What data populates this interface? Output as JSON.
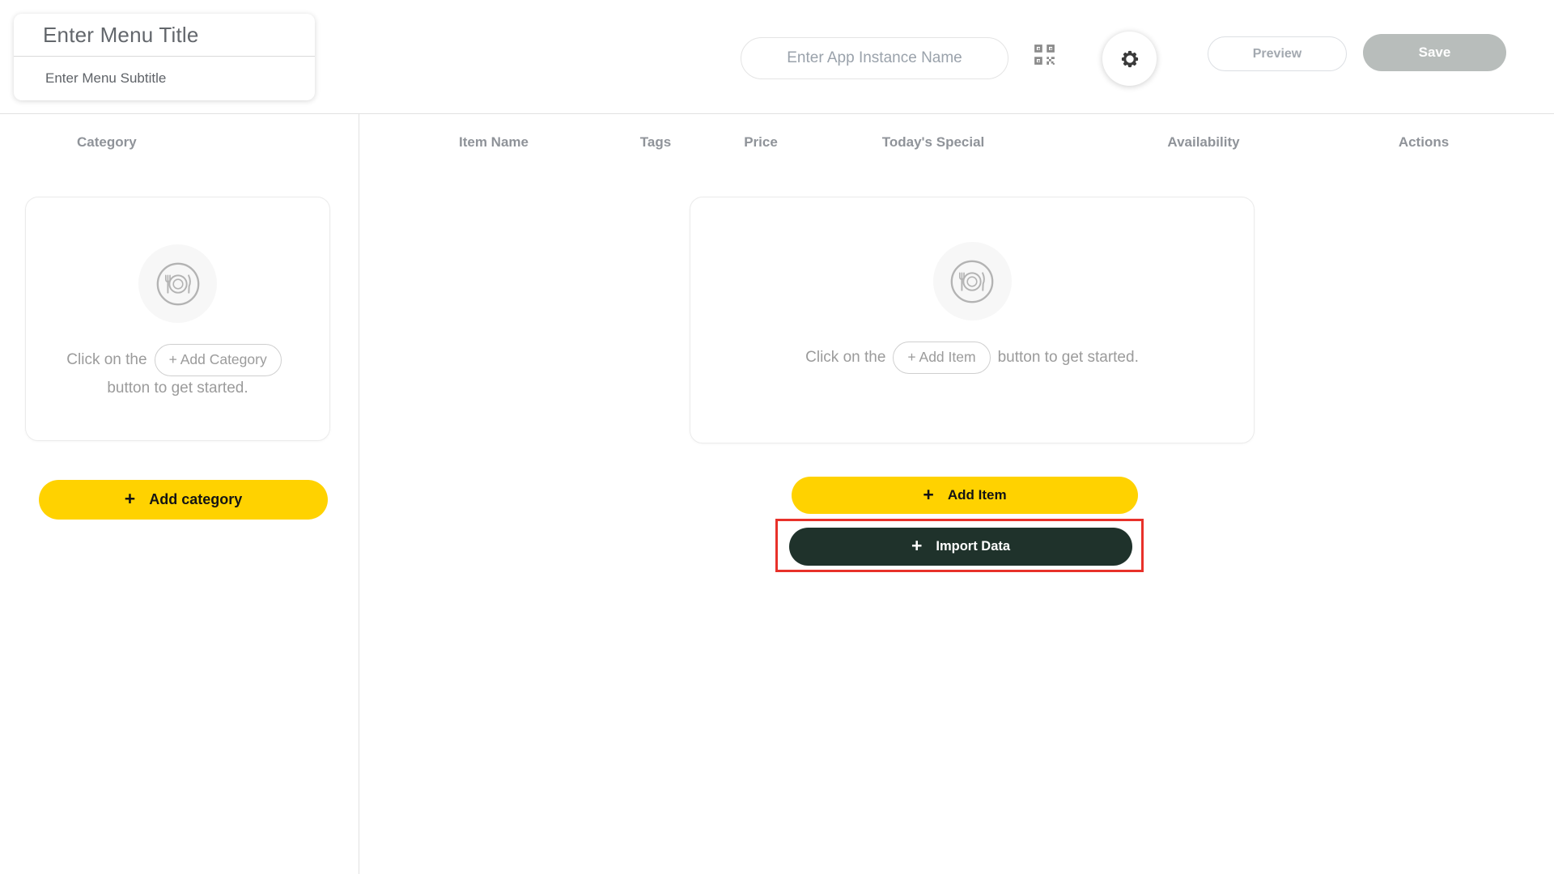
{
  "header": {
    "menu_title_placeholder": "Enter Menu Title",
    "menu_subtitle_placeholder": "Enter Menu Subtitle",
    "app_instance_placeholder": "Enter App Instance Name",
    "preview_label": "Preview",
    "save_label": "Save",
    "icons": {
      "qr": "qr-code-icon",
      "settings": "gear-icon"
    }
  },
  "category_panel": {
    "header": "Category",
    "empty_state": {
      "icon": "restaurant-plate-icon",
      "hint_prefix": "Click on the",
      "hint_pill": "+ Add Category",
      "hint_suffix": "button to get started."
    },
    "add_button": {
      "plus": "+",
      "label": "Add category"
    }
  },
  "items_panel": {
    "columns": [
      "Item Name",
      "Tags",
      "Price",
      "Today's Special",
      "Availability",
      "Actions"
    ],
    "empty_state": {
      "icon": "restaurant-plate-icon",
      "hint_prefix": "Click on the",
      "hint_pill": "+ Add Item",
      "hint_suffix": "button to get started."
    },
    "add_item_button": {
      "plus": "+",
      "label": "Add Item"
    },
    "import_data_button": {
      "plus": "+",
      "label": "Import Data"
    }
  },
  "colors": {
    "accent_yellow": "#FFD200",
    "dark_button": "#1F322B",
    "highlight_red": "#E8312A",
    "save_gray": "#B8BDBB"
  }
}
